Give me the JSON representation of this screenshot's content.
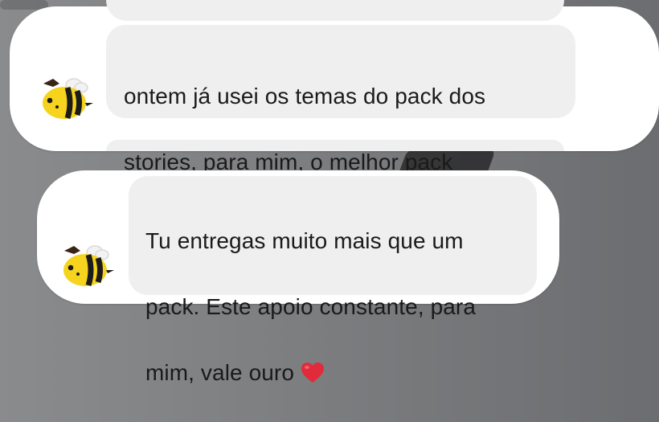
{
  "chat": {
    "messages": [
      {
        "lines": [
          "ontem já usei os temas do pack dos",
          "stories, para mim, o melhor pack"
        ],
        "avatar_icon": "bee-icon"
      },
      {
        "lines": [
          "Tu entregas muito mais que um",
          "pack. Este apoio constante, para",
          "mim, vale ouro"
        ],
        "emoji_icon": "red-heart-icon",
        "avatar_icon": "bee-icon"
      }
    ]
  },
  "colors": {
    "background": "#7d7e80",
    "card": "#ffffff",
    "bubble": "#efefef",
    "text": "#1a1a1a",
    "bee_yellow": "#f6d31d",
    "bee_stripe": "#1b1b1b",
    "heart": "#e12b3a"
  }
}
